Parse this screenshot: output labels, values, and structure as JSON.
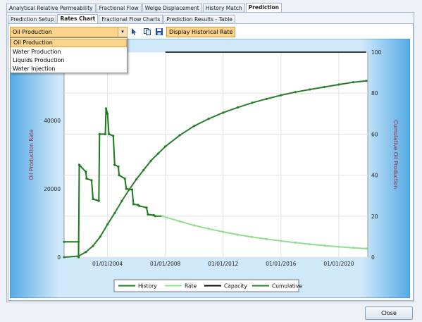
{
  "main_tabs": [
    "Analytical Relative Permeability",
    "Fractional Flow",
    "Welge Displacement",
    "History Match",
    "Prediction"
  ],
  "main_tab_active": 4,
  "sub_tabs": [
    "Prediction Setup",
    "Rates Chart",
    "Fractional Flow Charts",
    "Prediction Results - Table"
  ],
  "sub_tab_active": 1,
  "toolbar": {
    "combo_value": "Oil Production",
    "combo_arrow": "▾",
    "pointer_icon": "cursor-icon",
    "copy_icon": "copy-icon",
    "save_icon": "save-icon",
    "display_historical_label": "Display Historical Rate"
  },
  "dropdown_options": [
    "Oil Production",
    "Water Production",
    "Liquids Production",
    "Water Injection"
  ],
  "dropdown_selected": 0,
  "close_label": "Close",
  "colors": {
    "history": "#1b7a1b",
    "rate": "#8fdf8f",
    "capacity": "#000000",
    "cumulative": "#2a7d2a",
    "axis_title": "#9b2d3c",
    "frame": "#5aaee8"
  },
  "chart_data": {
    "type": "line",
    "xlabel": "",
    "ylabel": "Oil Production Rate",
    "y2label": "Cumulative Oil Production",
    "x_tick_labels": [
      "01/01/2004",
      "01/01/2008",
      "01/01/2012",
      "01/01/2016",
      "01/01/2020"
    ],
    "x_tick_years": [
      2004,
      2008,
      2012,
      2016,
      2020
    ],
    "xlim": [
      2001.0,
      2022.0
    ],
    "ylim": [
      0,
      60000
    ],
    "y_ticks": [
      0,
      20000,
      40000
    ],
    "y_tick_labels": [
      "0",
      "20000",
      "40000"
    ],
    "y2lim": [
      0,
      100
    ],
    "y2_ticks": [
      0,
      20,
      40,
      60,
      80,
      100
    ],
    "y2_tick_labels": [
      "0",
      "20",
      "40",
      "60",
      "80",
      "100"
    ],
    "grid": true,
    "legend_position": "bottom",
    "series": [
      {
        "name": "History",
        "axis": "left",
        "x": [
          2001.0,
          2002.0,
          2002.0,
          2002.05,
          2002.5,
          2002.55,
          2002.9,
          2003.0,
          2003.4,
          2003.45,
          2003.85,
          2003.9,
          2004.0,
          2004.1,
          2004.4,
          2004.5,
          2004.75,
          2004.8,
          2005.2,
          2005.3,
          2005.7,
          2005.8,
          2006.1,
          2006.2,
          2006.7,
          2006.8,
          2007.2,
          2007.3,
          2007.8
        ],
        "y": [
          4500,
          4500,
          0,
          27000,
          25000,
          23000,
          22500,
          17000,
          16500,
          36000,
          36000,
          43500,
          42000,
          36000,
          35500,
          27000,
          26500,
          24000,
          23000,
          20000,
          19800,
          15500,
          15300,
          15000,
          14500,
          12500,
          12300,
          12000,
          12000
        ]
      },
      {
        "name": "Rate",
        "axis": "left",
        "x": [
          2007.8,
          2009,
          2010,
          2011,
          2012,
          2013,
          2014,
          2015,
          2016,
          2017,
          2018,
          2019,
          2020,
          2021,
          2021.9
        ],
        "y": [
          12000,
          10500,
          9300,
          8300,
          7400,
          6600,
          5900,
          5300,
          4750,
          4250,
          3800,
          3400,
          3050,
          2750,
          2500
        ]
      },
      {
        "name": "Capacity",
        "axis": "left",
        "x": [
          2008.0,
          2021.9
        ],
        "y": [
          60000,
          60000
        ]
      },
      {
        "name": "Cumulative",
        "axis": "right",
        "x": [
          2001.0,
          2002.0,
          2002.5,
          2003.0,
          2003.5,
          2004.0,
          2004.5,
          2005.0,
          2005.5,
          2006.0,
          2006.5,
          2007.0,
          2007.5,
          2008.0,
          2009,
          2010,
          2011,
          2012,
          2013,
          2014,
          2015,
          2016,
          2017,
          2018,
          2019,
          2020,
          2021,
          2021.9
        ],
        "y": [
          0,
          0.5,
          2.5,
          5.5,
          10,
          16,
          21.5,
          27.5,
          33,
          38,
          42.5,
          47,
          50.5,
          54,
          59.5,
          64,
          67.5,
          70.5,
          73,
          75.3,
          77.2,
          79,
          80.5,
          81.8,
          83,
          84.2,
          85.3,
          86
        ]
      }
    ]
  }
}
